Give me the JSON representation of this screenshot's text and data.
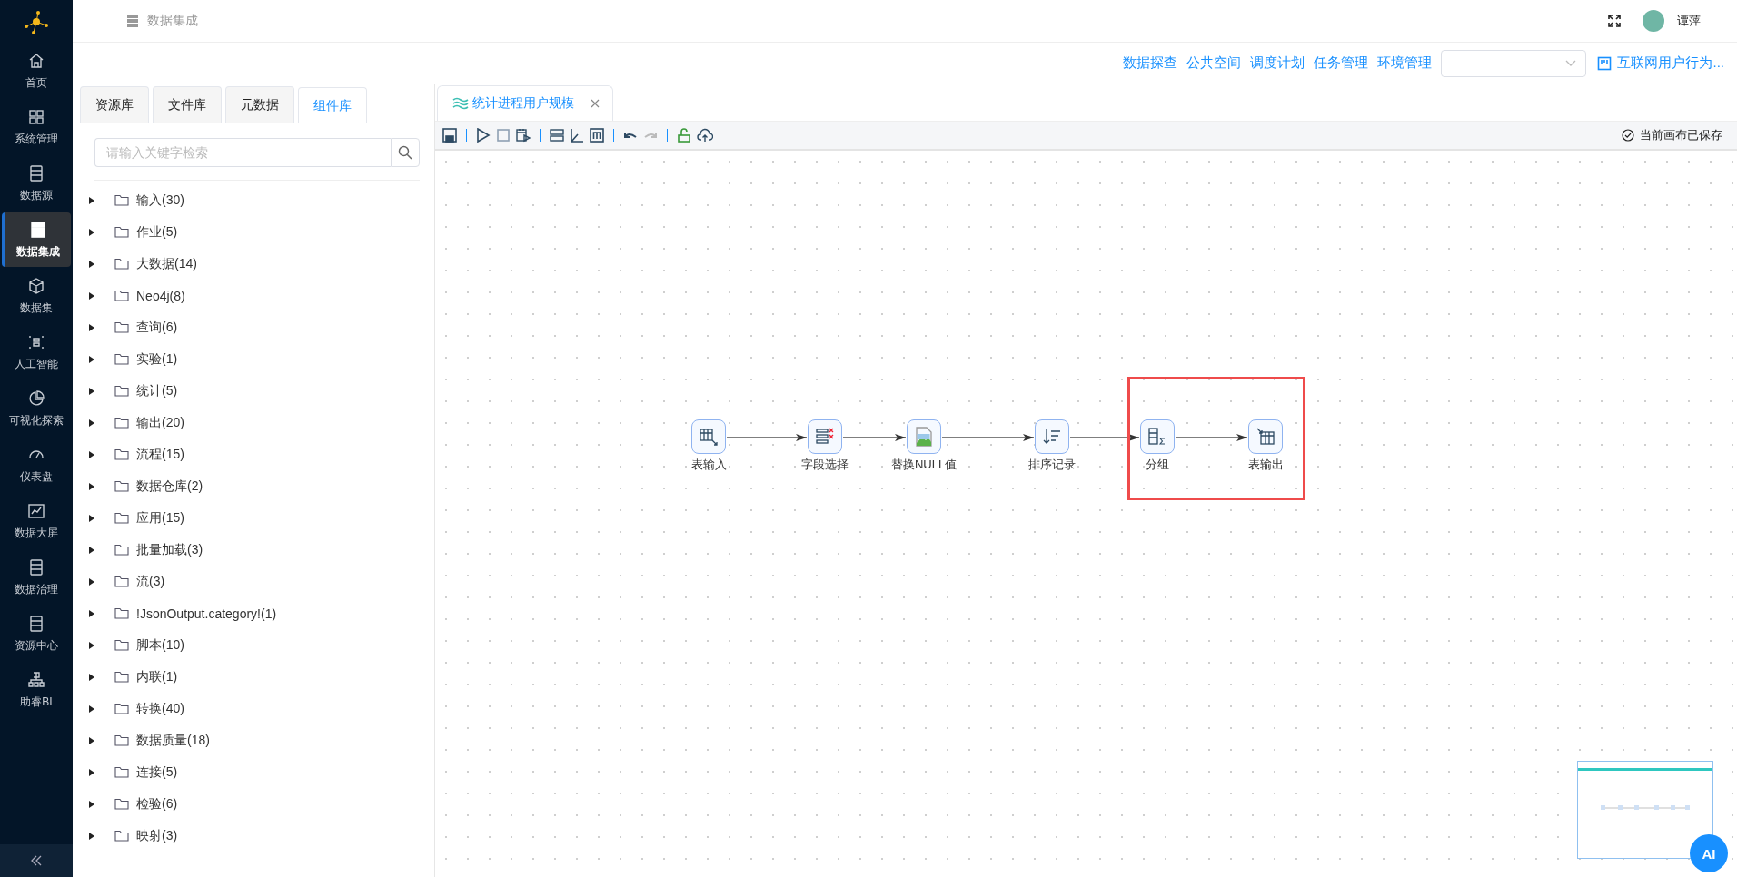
{
  "sidebar": {
    "items": [
      {
        "label": "首页",
        "selected": false
      },
      {
        "label": "系统管理",
        "selected": false
      },
      {
        "label": "数据源",
        "selected": false
      },
      {
        "label": "数据集成",
        "selected": true
      },
      {
        "label": "数据集",
        "selected": false
      },
      {
        "label": "人工智能",
        "selected": false
      },
      {
        "label": "可视化探索",
        "selected": false
      },
      {
        "label": "仪表盘",
        "selected": false
      },
      {
        "label": "数据大屏",
        "selected": false
      },
      {
        "label": "数据治理",
        "selected": false
      },
      {
        "label": "资源中心",
        "selected": false
      },
      {
        "label": "助睿BI",
        "selected": false
      }
    ]
  },
  "header": {
    "breadcrumb": "数据集成",
    "user": "谭萍"
  },
  "nav_links": [
    "数据探查",
    "公共空间",
    "调度计划",
    "任务管理",
    "环境管理"
  ],
  "project_link": "互联网用户行为...",
  "left_panel": {
    "tabs": [
      {
        "label": "资源库",
        "selected": false
      },
      {
        "label": "文件库",
        "selected": false
      },
      {
        "label": "元数据",
        "selected": false
      },
      {
        "label": "组件库",
        "selected": true
      }
    ],
    "search": {
      "placeholder": "请输入关键字检索"
    },
    "tree": [
      {
        "label": "输入(30)",
        "expanded": false
      },
      {
        "label": "作业(5)",
        "expanded": false
      },
      {
        "label": "大数据(14)",
        "expanded": false
      },
      {
        "label": "Neo4j(8)",
        "expanded": false
      },
      {
        "label": "查询(6)",
        "expanded": false
      },
      {
        "label": "实验(1)",
        "expanded": false
      },
      {
        "label": "统计(5)",
        "expanded": false
      },
      {
        "label": "输出(20)",
        "expanded": false
      },
      {
        "label": "流程(15)",
        "expanded": false
      },
      {
        "label": "数据仓库(2)",
        "expanded": false
      },
      {
        "label": "应用(15)",
        "expanded": false
      },
      {
        "label": "批量加载(3)",
        "expanded": false
      },
      {
        "label": "流(3)",
        "expanded": false
      },
      {
        "label": "!JsonOutput.category!(1)",
        "expanded": false
      },
      {
        "label": "脚本(10)",
        "expanded": false
      },
      {
        "label": "内联(1)",
        "expanded": false
      },
      {
        "label": "转换(40)",
        "expanded": false
      },
      {
        "label": "数据质量(18)",
        "expanded": false
      },
      {
        "label": "连接(5)",
        "expanded": false
      },
      {
        "label": "检验(6)",
        "expanded": false
      },
      {
        "label": "映射(3)",
        "expanded": false
      }
    ]
  },
  "editor": {
    "tabs": [
      {
        "label": "统计进程用户规模",
        "selected": true
      }
    ],
    "status": "当前画布已保存",
    "nodes": [
      {
        "label": "表输入",
        "kind": "input"
      },
      {
        "label": "字段选择",
        "kind": "select"
      },
      {
        "label": "替换NULL值",
        "kind": "image"
      },
      {
        "label": "排序记录",
        "kind": "sort"
      },
      {
        "label": "分组",
        "kind": "group"
      },
      {
        "label": "表输出",
        "kind": "output"
      }
    ],
    "ai_button": "AI"
  }
}
